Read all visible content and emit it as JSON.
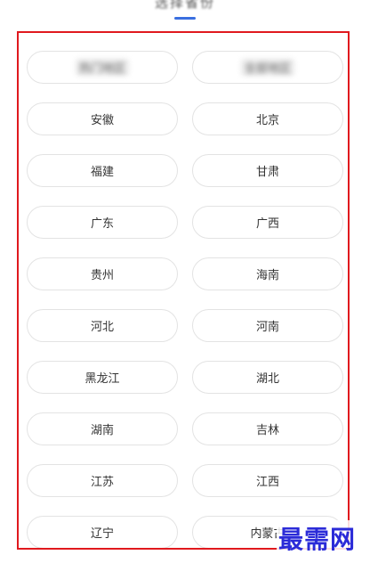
{
  "header": {
    "title": "选择省份"
  },
  "regions": [
    {
      "label": "热门地区"
    },
    {
      "label": "全部地区"
    },
    {
      "label": "安徽"
    },
    {
      "label": "北京"
    },
    {
      "label": "福建"
    },
    {
      "label": "甘肃"
    },
    {
      "label": "广东"
    },
    {
      "label": "广西"
    },
    {
      "label": "贵州"
    },
    {
      "label": "海南"
    },
    {
      "label": "河北"
    },
    {
      "label": "河南"
    },
    {
      "label": "黑龙江"
    },
    {
      "label": "湖北"
    },
    {
      "label": "湖南"
    },
    {
      "label": "吉林"
    },
    {
      "label": "江苏"
    },
    {
      "label": "江西"
    },
    {
      "label": "辽宁"
    },
    {
      "label": "内蒙古"
    }
  ],
  "watermark": "最需网",
  "colors": {
    "accent": "#3a6fe0",
    "frame": "#e0191e",
    "watermark": "#2b2bd8"
  }
}
